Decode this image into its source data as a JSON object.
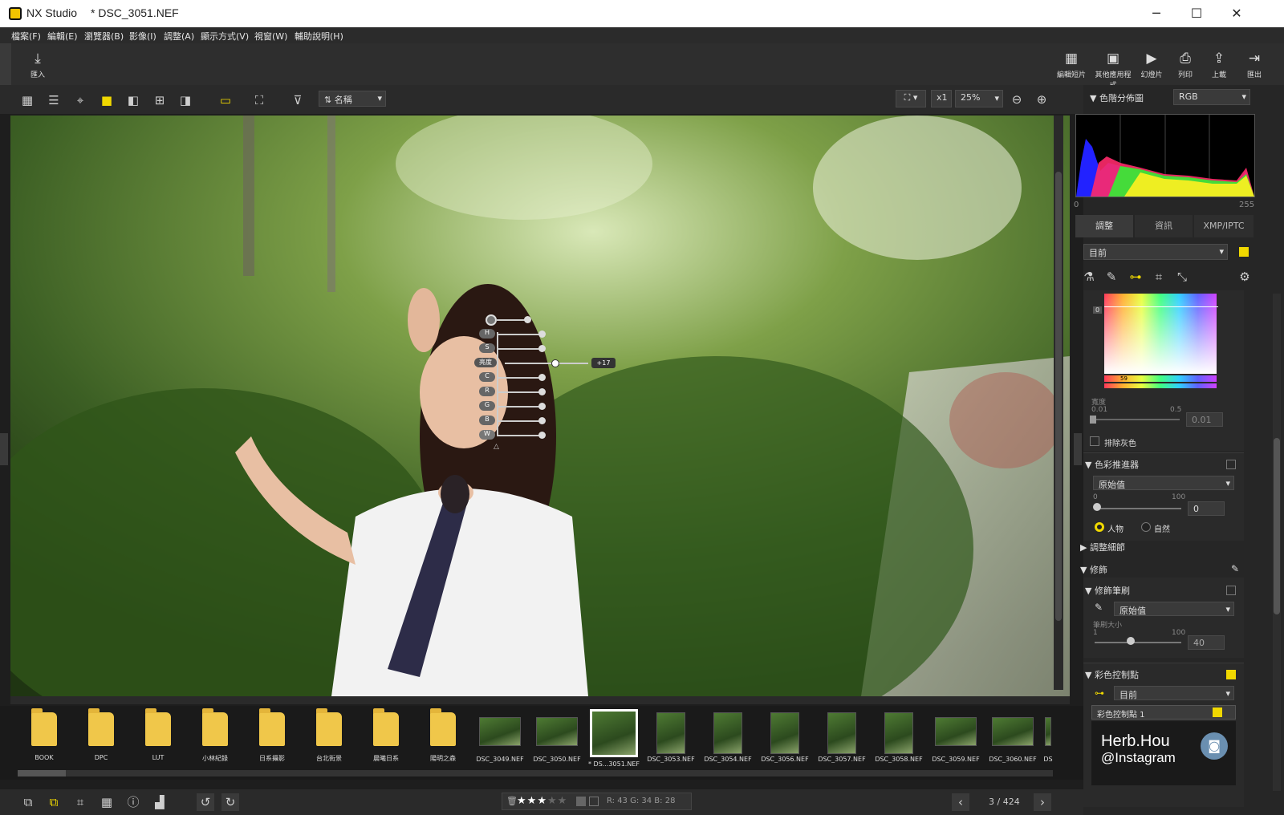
{
  "window": {
    "app_title": "NX Studio",
    "document_title": "* DSC_3051.NEF",
    "minimize": "─",
    "maximize": "☐",
    "close": "✕"
  },
  "menu": [
    "檔案(F)",
    "編輯(E)",
    "瀏覽器(B)",
    "影像(I)",
    "調整(A)",
    "顯示方式(V)",
    "視窗(W)",
    "輔助說明(H)"
  ],
  "top_toolbar": {
    "import": "匯入",
    "right_buttons": [
      "編輯短片",
      "其他應用程式",
      "幻燈片",
      "列印",
      "上載",
      "匯出"
    ]
  },
  "view_toolbar": {
    "sort_label": "名稱",
    "zoom_ratio": "x1",
    "zoom_percent": "25%"
  },
  "control_point": {
    "labels": [
      "H",
      "S",
      "亮度",
      "C",
      "R",
      "G",
      "B",
      "W"
    ],
    "value": "+17"
  },
  "filmstrip": {
    "folders": [
      "BOOK",
      "DPC",
      "LUT",
      "小林紀錄",
      "日系攝影",
      "台北街景",
      "晨曦日系",
      "陽明之森"
    ],
    "images": [
      "DSC_3049.NEF",
      "DSC_3050.NEF",
      "* DS...3051.NEF",
      "DSC_3053.NEF",
      "DSC_3054.NEF",
      "DSC_3056.NEF",
      "DSC_3057.NEF",
      "DSC_3058.NEF",
      "DSC_3059.NEF",
      "DSC_3060.NEF",
      "DS"
    ],
    "selected_index": 2
  },
  "status": {
    "rating_stars": 3,
    "rating_max": 5,
    "rgb": "R: 43  G: 34  B: 28",
    "page": "3 / 424"
  },
  "right_panel": {
    "histogram_title": "色階分佈圖",
    "histogram_mode": "RGB",
    "hist_min": "0",
    "hist_max": "255",
    "tabs": [
      "調整",
      "資訊",
      "XMP/IPTC"
    ],
    "preset": "目前",
    "picker_marker": "0",
    "picker_value": "59",
    "width_label": "寬度",
    "width_min": "0.01",
    "width_max": "0.5",
    "width_value": "0.01",
    "exclude_gray": "排除灰色",
    "color_booster_title": "色彩推進器",
    "booster_preset": "原始值",
    "booster_min": "0",
    "booster_max": "100",
    "booster_value": "0",
    "radio_people": "人物",
    "radio_nature": "自然",
    "fine_tune": "調整細節",
    "retouch": "修飾",
    "retouch_brush": "修飾筆刷",
    "brush_preset": "原始值",
    "brush_size_label": "筆刷大小",
    "brush_min": "1",
    "brush_max": "100",
    "brush_value": "40",
    "color_control_title": "彩色控制點",
    "ccp_preset": "目前",
    "ccp_item": "彩色控制點 1",
    "watermark_line1": "Herb.Hou",
    "watermark_line2": "@Instagram"
  },
  "colors": {
    "accent": "#f0d800",
    "panel_bg": "#262626"
  }
}
